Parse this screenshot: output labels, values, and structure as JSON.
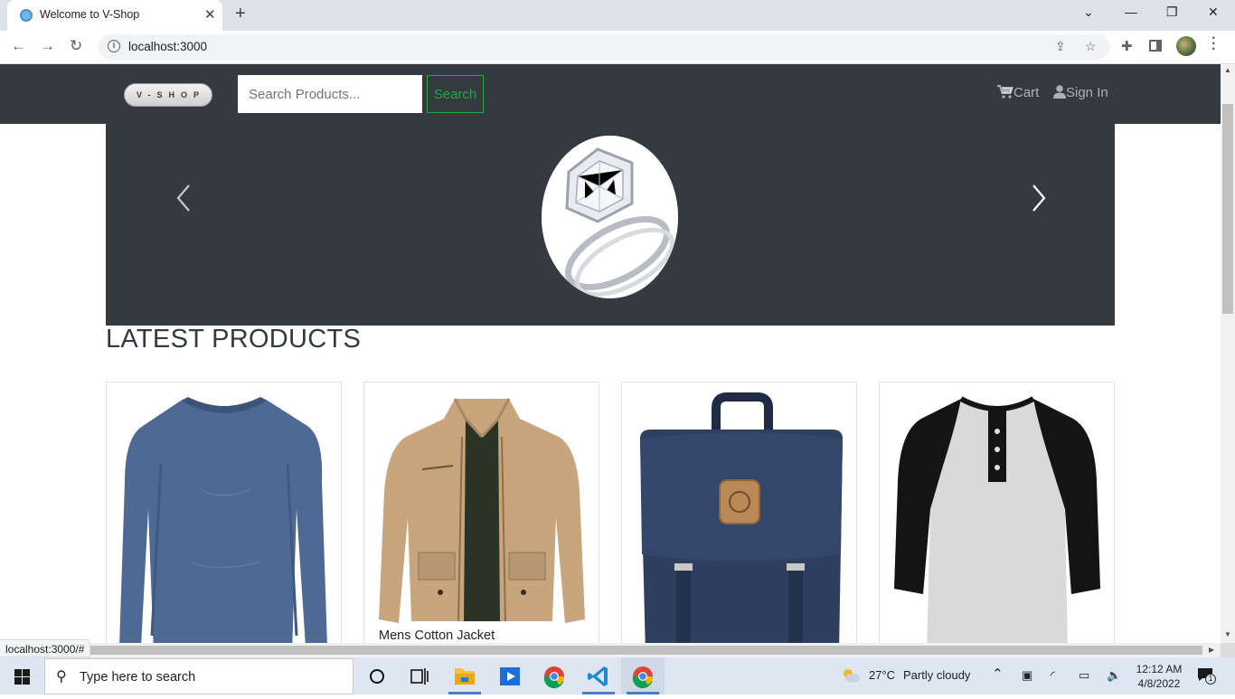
{
  "browser": {
    "tab_title": "Welcome to V-Shop",
    "tab_close": "✕",
    "new_tab": "+",
    "url": "localhost:3000",
    "status_url": "localhost:3000/#",
    "window_controls": {
      "dropdown": "⌄",
      "minimize": "—",
      "restore": "❐",
      "close": "✕"
    }
  },
  "header": {
    "logo_text": "V-SHOP",
    "search_placeholder": "Search Products...",
    "search_button": "Search",
    "cart_label": "Cart",
    "signin_label": "Sign In",
    "accent_color": "#28a745",
    "background_color": "#343a40"
  },
  "carousel": {
    "image": "diamond-ring"
  },
  "products_section": {
    "title": "LATEST PRODUCTS",
    "products": [
      {
        "name": "",
        "image": "blue-long-sleeve-tee"
      },
      {
        "name": "Mens Cotton Jacket",
        "image": "beige-cotton-jacket"
      },
      {
        "name": "",
        "image": "navy-backpack"
      },
      {
        "name": "",
        "image": "raglan-henley-tee"
      }
    ]
  },
  "taskbar": {
    "search_text": "Type here to search",
    "weather_temp": "27°C",
    "weather_text": "Partly cloudy",
    "time": "12:12 AM",
    "date": "4/8/2022",
    "notification_count": "1"
  }
}
